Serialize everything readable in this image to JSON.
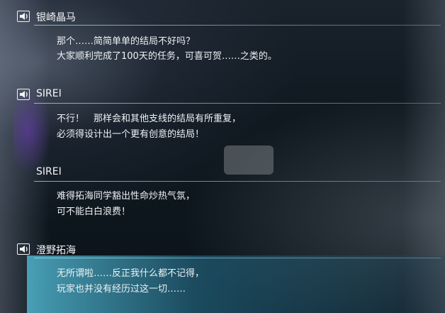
{
  "dialogue": [
    {
      "speaker": "银崎晶马",
      "has_voice": true,
      "lines": [
        "那个……简简单单的结局不好吗？",
        "大家顺利完成了100天的任务，可喜可贺……之类的。"
      ]
    },
    {
      "speaker": "SIREI",
      "has_voice": true,
      "lines": [
        "不行！　那样会和其他支线的结局有所重复，",
        "必须得设计出一个更有创意的结局！"
      ]
    },
    {
      "speaker": "SIREI",
      "has_voice": false,
      "lines": [
        "难得拓海同学豁出性命炒热气氛，",
        "可不能白白浪费！"
      ]
    },
    {
      "speaker": "澄野拓海",
      "has_voice": true,
      "lines": [
        "无所谓啦……反正我什么都不记得，",
        "玩家也并没有经历过这一切……"
      ]
    }
  ],
  "colors": {
    "accent_line": "#b4dcEB",
    "highlight": "#50b4cd"
  }
}
